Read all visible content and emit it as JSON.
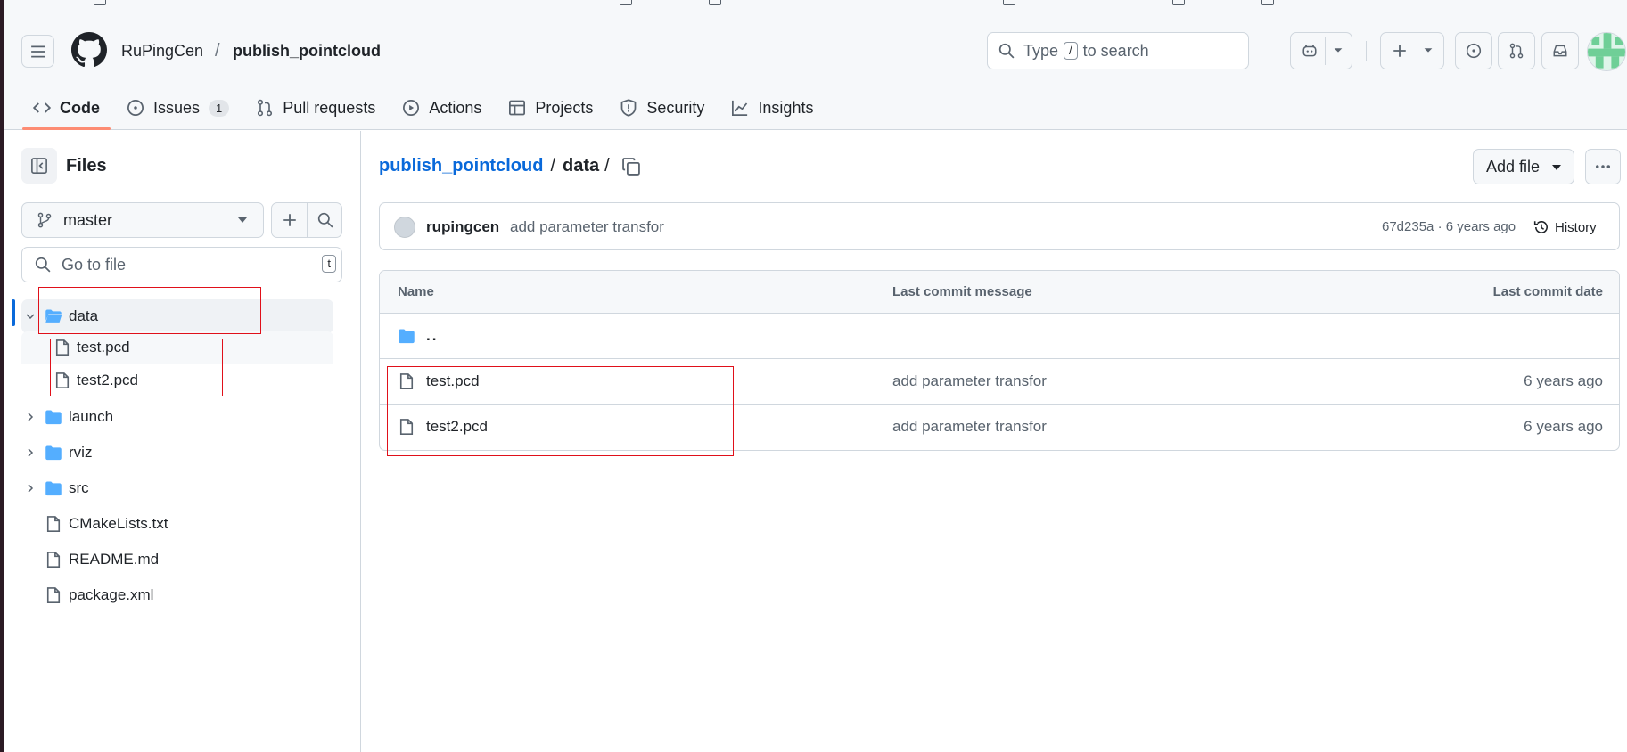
{
  "header": {
    "owner": "RuPingCen",
    "separator": "/",
    "repo": "publish_pointcloud",
    "search": {
      "prefix": "Type",
      "key": "/",
      "suffix": "to search"
    }
  },
  "nav": {
    "tabs": [
      {
        "label": "Code",
        "icon": "code-icon"
      },
      {
        "label": "Issues",
        "icon": "issue-icon",
        "count": "1"
      },
      {
        "label": "Pull requests",
        "icon": "pull-request-icon"
      },
      {
        "label": "Actions",
        "icon": "play-icon"
      },
      {
        "label": "Projects",
        "icon": "table-icon"
      },
      {
        "label": "Security",
        "icon": "shield-icon"
      },
      {
        "label": "Insights",
        "icon": "graph-icon"
      }
    ]
  },
  "sidebar": {
    "title": "Files",
    "branch": "master",
    "goto_placeholder": "Go to file",
    "goto_key": "t",
    "tree": [
      {
        "label": "data",
        "type": "folder",
        "expanded": true
      },
      {
        "label": "test.pcd",
        "type": "file"
      },
      {
        "label": "test2.pcd",
        "type": "file"
      },
      {
        "label": "launch",
        "type": "folder"
      },
      {
        "label": "rviz",
        "type": "folder"
      },
      {
        "label": "src",
        "type": "folder"
      },
      {
        "label": "CMakeLists.txt",
        "type": "file"
      },
      {
        "label": "README.md",
        "type": "file"
      },
      {
        "label": "package.xml",
        "type": "file"
      }
    ]
  },
  "main": {
    "breadcrumb": {
      "repo": "publish_pointcloud",
      "sep": "/",
      "folder": "data",
      "trail": "/"
    },
    "add_file": "Add file",
    "commit": {
      "author": "rupingcen",
      "message": "add parameter transfor",
      "meta": "67d235a · 6 years ago",
      "history": "History"
    },
    "table": {
      "headers": {
        "name": "Name",
        "message": "Last commit message",
        "date": "Last commit date"
      },
      "parent": "..",
      "rows": [
        {
          "name": "test.pcd",
          "message": "add parameter transfor",
          "date": "6 years ago"
        },
        {
          "name": "test2.pcd",
          "message": "add parameter transfor",
          "date": "6 years ago"
        }
      ]
    }
  },
  "colors": {
    "accent": "#0969da",
    "folder": "#54aeff",
    "tab_underline": "#fd8c73",
    "annotation": "#e0101a"
  }
}
